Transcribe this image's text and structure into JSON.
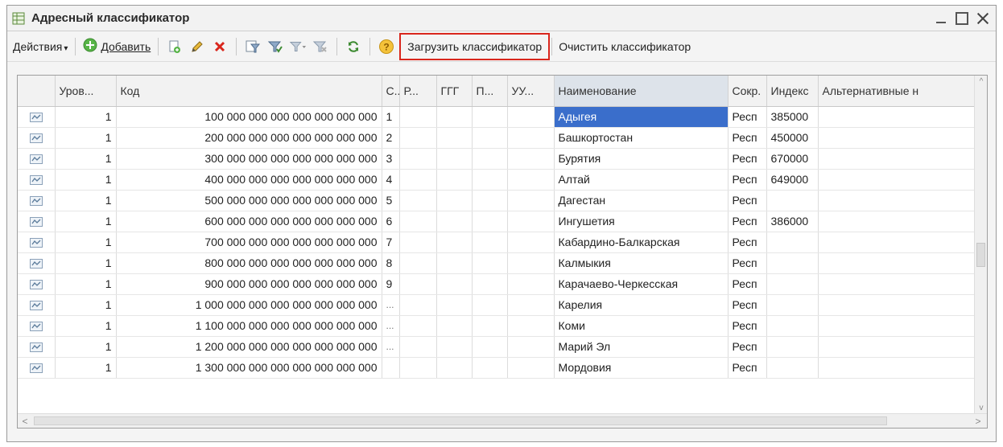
{
  "window": {
    "title": "Адресный классификатор"
  },
  "toolbar": {
    "actions_label": "Действия",
    "add_label": "Добавить",
    "load_label": "Загрузить классификатор",
    "clear_label": "Очистить классификатор"
  },
  "grid": {
    "columns": [
      "Уров...",
      "Код",
      "С...",
      "Р...",
      "ГГГ",
      "П...",
      "УУ...",
      "Наименование",
      "Сокр.",
      "Индекс",
      "Альтернативные н"
    ],
    "rows": [
      {
        "level": "1",
        "code": "100 000 000 000 000 000 000 000",
        "s": "1",
        "name": "Адыгея",
        "abbr": "Респ",
        "index": "385000"
      },
      {
        "level": "1",
        "code": "200 000 000 000 000 000 000 000",
        "s": "2",
        "name": "Башкортостан",
        "abbr": "Респ",
        "index": "450000"
      },
      {
        "level": "1",
        "code": "300 000 000 000 000 000 000 000",
        "s": "3",
        "name": "Бурятия",
        "abbr": "Респ",
        "index": "670000"
      },
      {
        "level": "1",
        "code": "400 000 000 000 000 000 000 000",
        "s": "4",
        "name": "Алтай",
        "abbr": "Респ",
        "index": "649000"
      },
      {
        "level": "1",
        "code": "500 000 000 000 000 000 000 000",
        "s": "5",
        "name": "Дагестан",
        "abbr": "Респ",
        "index": ""
      },
      {
        "level": "1",
        "code": "600 000 000 000 000 000 000 000",
        "s": "6",
        "name": "Ингушетия",
        "abbr": "Респ",
        "index": "386000"
      },
      {
        "level": "1",
        "code": "700 000 000 000 000 000 000 000",
        "s": "7",
        "name": "Кабардино-Балкарская",
        "abbr": "Респ",
        "index": ""
      },
      {
        "level": "1",
        "code": "800 000 000 000 000 000 000 000",
        "s": "8",
        "name": "Калмыкия",
        "abbr": "Респ",
        "index": ""
      },
      {
        "level": "1",
        "code": "900 000 000 000 000 000 000 000",
        "s": "9",
        "name": "Карачаево-Черкесская",
        "abbr": "Респ",
        "index": ""
      },
      {
        "level": "1",
        "code": "1 000 000 000 000 000 000 000 000",
        "s": "...",
        "name": "Карелия",
        "abbr": "Респ",
        "index": ""
      },
      {
        "level": "1",
        "code": "1 100 000 000 000 000 000 000 000",
        "s": "...",
        "name": "Коми",
        "abbr": "Респ",
        "index": ""
      },
      {
        "level": "1",
        "code": "1 200 000 000 000 000 000 000 000",
        "s": "...",
        "name": "Марий Эл",
        "abbr": "Респ",
        "index": ""
      },
      {
        "level": "1",
        "code": "1 300 000 000 000 000 000 000 000",
        "s": "",
        "name": "Мордовия",
        "abbr": "Респ",
        "index": ""
      }
    ]
  },
  "colors": {
    "highlight_border": "#d9261c",
    "selected_cell": "#3a6ecb",
    "sorted_header": "#dde3ea"
  },
  "icons": {
    "title": "table-icon",
    "add": "green-plus-circle-icon",
    "copy": "copy-document-icon",
    "edit": "pencil-icon",
    "delete": "red-cross-icon",
    "filter": "filter-icon",
    "filter_set": "filter-set-icon",
    "filter_history": "filter-history-icon",
    "filter_clear": "filter-clear-icon",
    "refresh": "refresh-icon",
    "help": "help-icon",
    "row": "element-row-icon"
  }
}
